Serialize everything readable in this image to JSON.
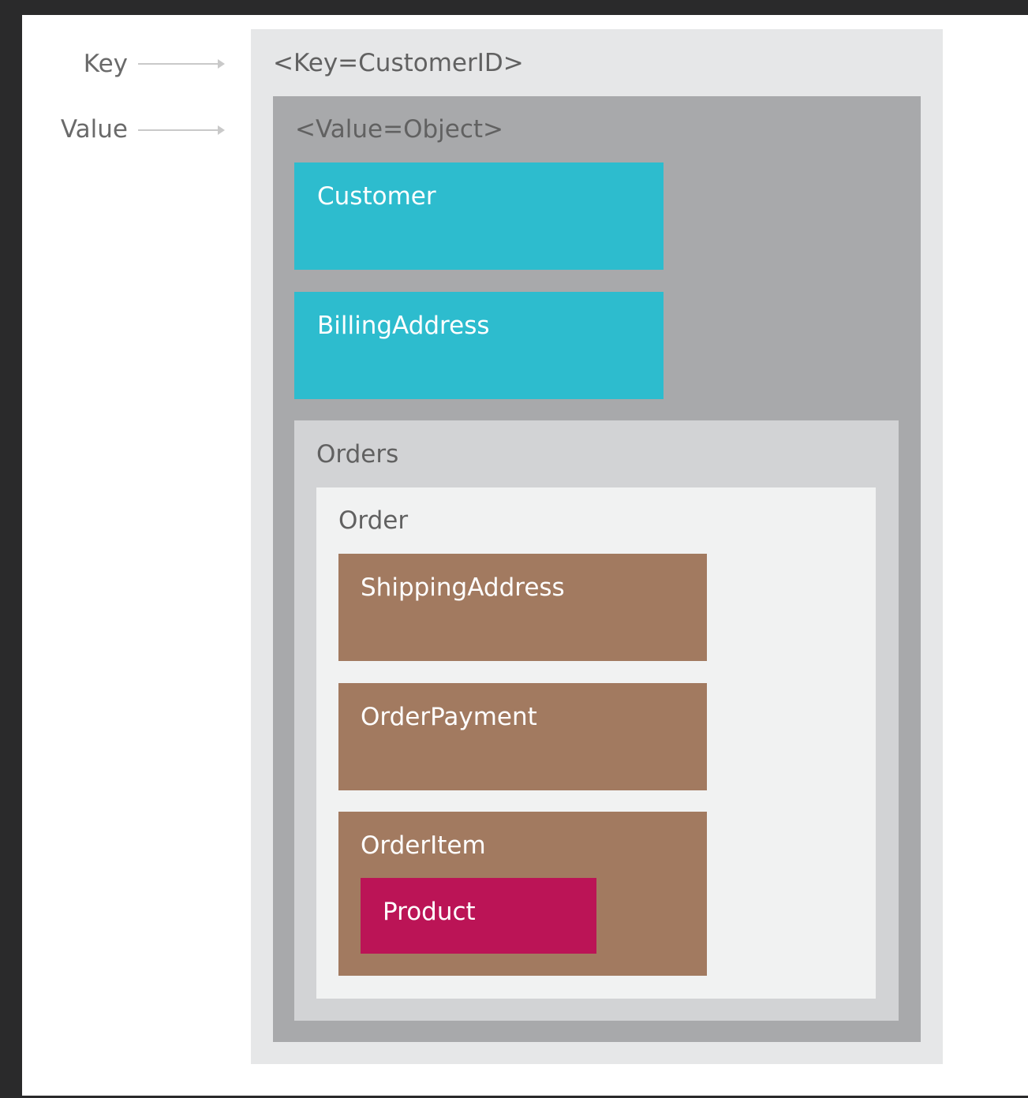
{
  "labels": {
    "key": "Key",
    "value": "Value"
  },
  "key_frame": {
    "title": "<Key=CustomerID>"
  },
  "value_frame": {
    "title": "<Value=Object>"
  },
  "customer": {
    "title": "Customer"
  },
  "billing_address": {
    "title": "BillingAddress"
  },
  "orders": {
    "title": "Orders"
  },
  "order": {
    "title": "Order"
  },
  "shipping_address": {
    "title": "ShippingAddress"
  },
  "order_payment": {
    "title": "OrderPayment"
  },
  "order_item": {
    "title": "OrderItem"
  },
  "product": {
    "title": "Product"
  },
  "colors": {
    "key_frame": "#e6e7e8",
    "value_frame": "#a8a9ab",
    "orders_frame": "#d2d3d5",
    "order_frame": "#f1f2f2",
    "cyan": "#2dbcce",
    "brown": "#a27a60",
    "magenta": "#bb1456"
  }
}
